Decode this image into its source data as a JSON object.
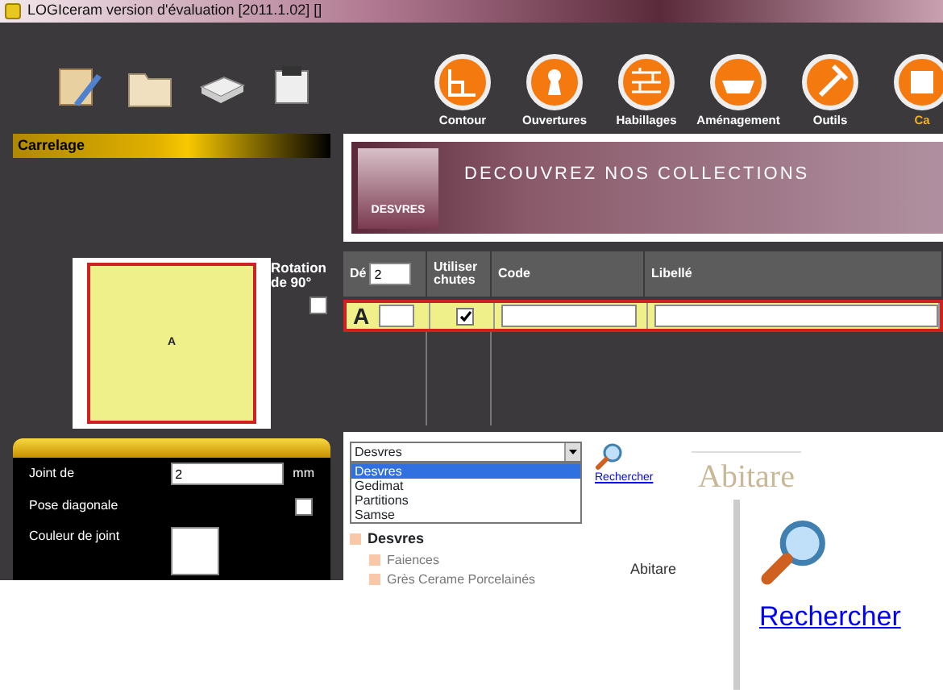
{
  "window": {
    "title": "LOGIceram version d'évaluation [2011.1.02] []"
  },
  "toolbar": [
    {
      "label": "Contour",
      "selected": false
    },
    {
      "label": "Ouvertures",
      "selected": false
    },
    {
      "label": "Habillages",
      "selected": false
    },
    {
      "label": "Aménagement",
      "selected": false
    },
    {
      "label": "Outils",
      "selected": false
    },
    {
      "label": "Ca",
      "selected": true
    }
  ],
  "panel": {
    "title": "Carrelage"
  },
  "banner": {
    "brand": "DESVRES",
    "headline": "DECOUVREZ NOS COLLECTIONS"
  },
  "preview": {
    "label": "A"
  },
  "rotation": {
    "label": "Rotation de 90°",
    "checked": false
  },
  "grid": {
    "columns": [
      "Dé",
      "Utiliser chutes",
      "Code",
      "Libellé"
    ],
    "offset_value": "2",
    "rows": [
      {
        "letter": "A",
        "chutes": true,
        "selected": true
      }
    ]
  },
  "settings": {
    "joint_label": "Joint de",
    "joint_value": "2",
    "joint_unit": "mm",
    "diagonal_label": "Pose diagonale",
    "diagonal_checked": false,
    "color_label": "Couleur de joint"
  },
  "supplier": {
    "value": "Desvres",
    "options": [
      {
        "label": "Desvres",
        "selected": true
      },
      {
        "label": "Gedimat",
        "selected": false
      },
      {
        "label": "Partitions",
        "selected": false
      },
      {
        "label": "Samse",
        "selected": false
      }
    ]
  },
  "tree": [
    {
      "label": "Desvres",
      "children": [
        {
          "label": "Faiences"
        },
        {
          "label": "Grès Ceramе Porcelainés"
        }
      ]
    }
  ],
  "search": {
    "label": "Rechercher"
  },
  "logo": {
    "label": "Abitare",
    "caption": "Abitare"
  },
  "inset": {
    "label": "Rechercher"
  }
}
